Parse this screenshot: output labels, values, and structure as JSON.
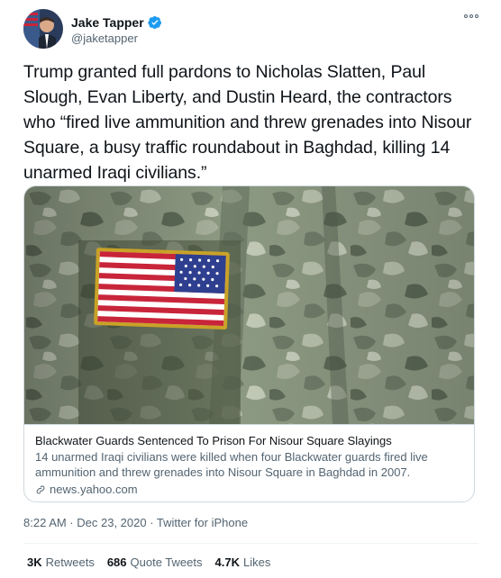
{
  "author": {
    "name": "Jake Tapper",
    "handle": "@jaketapper",
    "avatar_icon": "profile-photo",
    "verified_icon": "verified-badge-icon",
    "verified_color": "#1d9bf0"
  },
  "tweet": {
    "text": "Trump granted full pardons to Nicholas Slatten, Paul Slough, Evan Liberty, and Dustin Heard, the contractors who “fired live ammunition and threw grenades into Nisour Square, a busy traffic roundabout in Baghdad, killing 14 unarmed Iraqi civilians.”",
    "more_icon": "more-options-icon"
  },
  "card": {
    "image_icon": "us-flag-patch-on-camouflage-uniform",
    "title": "Blackwater Guards Sentenced To Prison For Nisour Square Slayings",
    "description": "14 unarmed Iraqi civilians were killed when four Blackwater guards fired live ammunition and threw grenades into Nisour Square in Baghdad in 2007.",
    "link_icon": "link-icon",
    "domain": "news.yahoo.com"
  },
  "meta": {
    "line": "8:22 AM · Dec 23, 2020 · Twitter for iPhone"
  },
  "stats": {
    "retweets_count": "3K",
    "retweets_label": "Retweets",
    "quotes_count": "686",
    "quotes_label": "Quote Tweets",
    "likes_count": "4.7K",
    "likes_label": "Likes"
  },
  "colors": {
    "text_primary": "#0f1419",
    "text_secondary": "#536471",
    "border": "#cfd9de",
    "flag_red": "#c8253a",
    "flag_blue": "#2e3f8f",
    "patch_border": "#c9a227"
  }
}
